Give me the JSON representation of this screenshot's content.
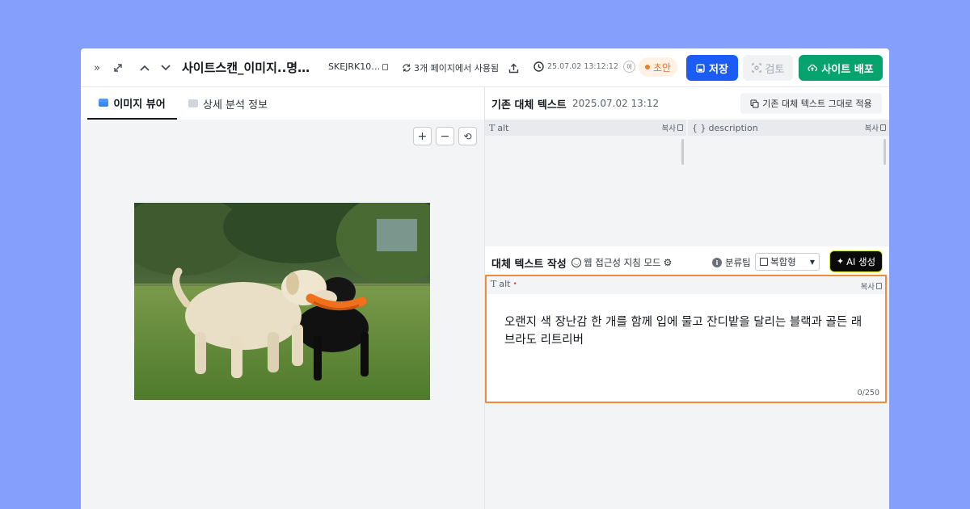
{
  "toolbar": {
    "doc_title": "사이트스캔_이미지..명…",
    "doc_code": "SKEJRK10…",
    "usage_text": "3개 페이지에서 사용됨",
    "timestamp": "25.07.02 13:12:12",
    "user_initial": "이",
    "status": "초안",
    "save_label": "저장",
    "review_label": "검토",
    "deploy_label": "사이트 배포"
  },
  "left": {
    "tabs": [
      {
        "label": "이미지 뷰어",
        "active": true
      },
      {
        "label": "상세 분석 정보",
        "active": false
      }
    ],
    "zoom": {
      "plus": "+",
      "minus": "−",
      "reset": "⟲"
    }
  },
  "existing": {
    "title": "기존 대체 텍스트",
    "date": "2025.07.02 13:12",
    "apply_label": "기존 대체 텍스트 그대로 적용",
    "fields": [
      {
        "label": "alt",
        "copy": "복사",
        "value": ""
      },
      {
        "label": "description",
        "copy": "복사",
        "value": ""
      }
    ]
  },
  "compose": {
    "title": "대체 텍스트 작성",
    "mode_label": "웹 접근성 지침 모드",
    "classify_label": "분류팁",
    "select_value": "복합형",
    "ai_label": "AI 생성",
    "field_label": "alt",
    "copy": "복사",
    "value": "오랜지 색 장난감 한 개를 함께 입에 물고 잔디밭을 달리는 블랙과 골든 래브라도 리트리버",
    "counter": "0/250"
  },
  "colors": {
    "background": "#859ffd",
    "save": "#1a5cf5",
    "deploy": "#07a36e",
    "status": "#e8702a",
    "edit_border": "#f28a3a"
  }
}
